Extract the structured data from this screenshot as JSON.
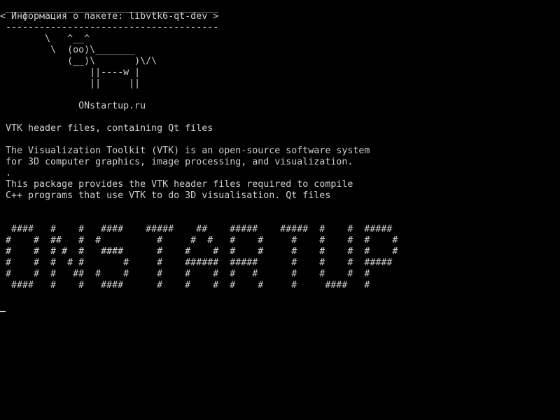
{
  "terminal": {
    "colors": {
      "background": "#000000",
      "foreground": "#cfcfcf"
    },
    "cowsay_bubble": {
      "top_border": " ______________________________________",
      "message": "< Информация о пакете: libvtk6-qt-dev >",
      "bottom_border": " --------------------------------------"
    },
    "cow_art": "        \\   ^__^\n         \\  (oo)\\_______\n            (__)\\       )\\/\\\n                ||----w |\n                ||     ||",
    "site_label": "              ONstartup.ru",
    "package_summary": " VTK header files, containing Qt files",
    "description": " The Visualization Toolkit (VTK) is an open-source software system\n for 3D computer graphics, image processing, and visualization.\n .\n This package provides the VTK header files required to compile\n C++ programs that use VTK to do 3D visualisation. Qt files",
    "banner_art": "  ####   #    #   ####    #####    ##    #####    #####  #    #  #####\n #    #  ##   #  #          #     #  #   #    #     #    #    #  #    #\n #    #  # #  #   ####      #    #    #  #    #     #    #    #  #    #\n #    #  #  # #       #     #    ######  #####      #    #    #  #####\n #    #  #   ##  #    #     #    #    #  #   #      #    #    #  #\n  ####   #    #   ####      #    #    #  #    #     #     ####   #"
  }
}
